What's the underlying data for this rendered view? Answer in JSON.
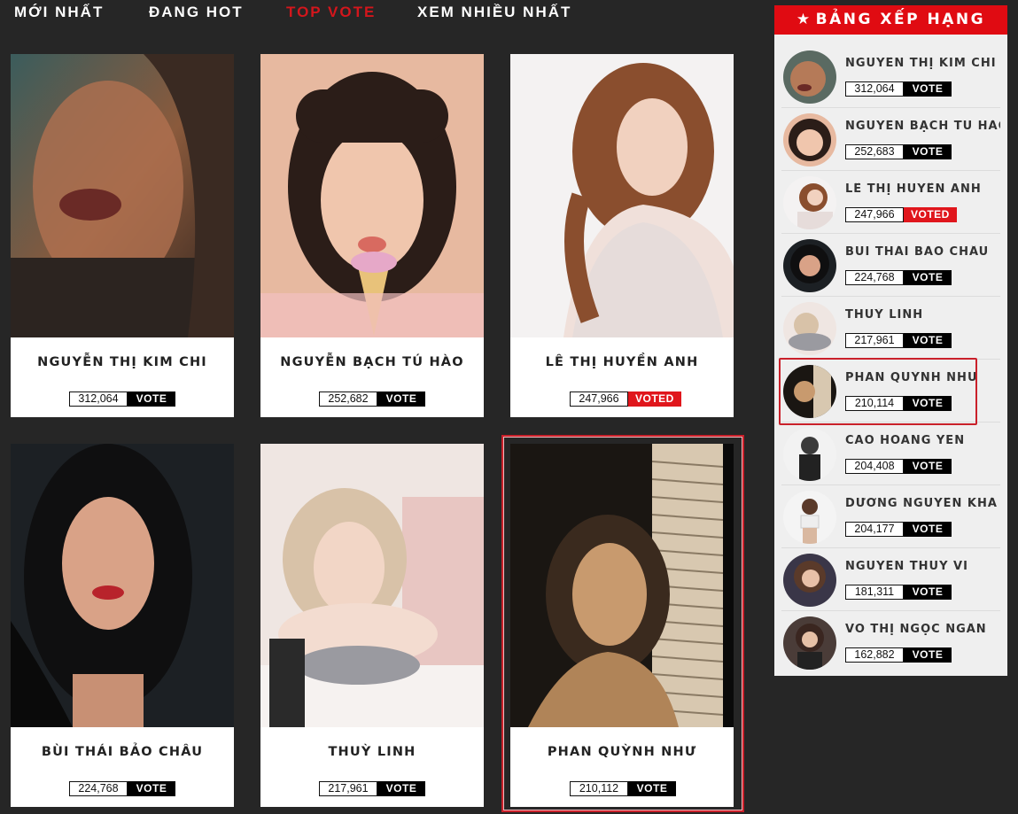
{
  "nav": {
    "items": [
      {
        "label": "MỚI NHẤT",
        "active": false
      },
      {
        "label": "ĐANG HOT",
        "active": false
      },
      {
        "label": "TOP VOTE",
        "active": true
      },
      {
        "label": "XEM NHIỀU NHẤT",
        "active": false
      }
    ]
  },
  "cards": [
    {
      "name": "NGUYỄN THỊ KIM CHI",
      "count": "312,064",
      "vote": "VOTE",
      "voted": false
    },
    {
      "name": "NGUYỄN BẠCH TÚ HÀO",
      "count": "252,682",
      "vote": "VOTE",
      "voted": false
    },
    {
      "name": "LÊ THỊ HUYỀN ANH",
      "count": "247,966",
      "vote": "VOTED",
      "voted": true
    },
    {
      "name": "BÙI THÁI BẢO CHÂU",
      "count": "224,768",
      "vote": "VOTE",
      "voted": false
    },
    {
      "name": "THUỲ LINH",
      "count": "217,961",
      "vote": "VOTE",
      "voted": false
    },
    {
      "name": "PHAN QUỲNH NHƯ",
      "count": "210,112",
      "vote": "VOTE",
      "voted": false
    }
  ],
  "sidebar": {
    "title": "BẢNG XẾP HẠNG",
    "star": "★",
    "items": [
      {
        "name": "NGUYỄN THỊ KIM CHI",
        "count": "312,064",
        "vote": "VOTE",
        "voted": false
      },
      {
        "name": "NGUYỄN BẠCH TÚ HÀO",
        "count": "252,683",
        "vote": "VOTE",
        "voted": false
      },
      {
        "name": "LÊ THỊ HUYỀN ANH",
        "count": "247,966",
        "vote": "VOTED",
        "voted": true
      },
      {
        "name": "BÙI THÁI BẢO CHÂU",
        "count": "224,768",
        "vote": "VOTE",
        "voted": false
      },
      {
        "name": "THUỲ LINH",
        "count": "217,961",
        "vote": "VOTE",
        "voted": false
      },
      {
        "name": "PHAN QUỲNH NHƯ",
        "count": "210,114",
        "vote": "VOTE",
        "voted": false
      },
      {
        "name": "CAO HOANG YEN",
        "count": "204,408",
        "vote": "VOTE",
        "voted": false
      },
      {
        "name": "DƯƠNG NGUYỄN KHÁ ...",
        "count": "204,177",
        "vote": "VOTE",
        "voted": false
      },
      {
        "name": "NGUYỄN THÚY VI",
        "count": "181,311",
        "vote": "VOTE",
        "voted": false
      },
      {
        "name": "VÕ THỊ NGỌC NGÂN",
        "count": "162,882",
        "vote": "VOTE",
        "voted": false
      }
    ]
  },
  "colors": {
    "accent": "#e00b12",
    "background": "#262626",
    "voted": "#e0161c"
  }
}
